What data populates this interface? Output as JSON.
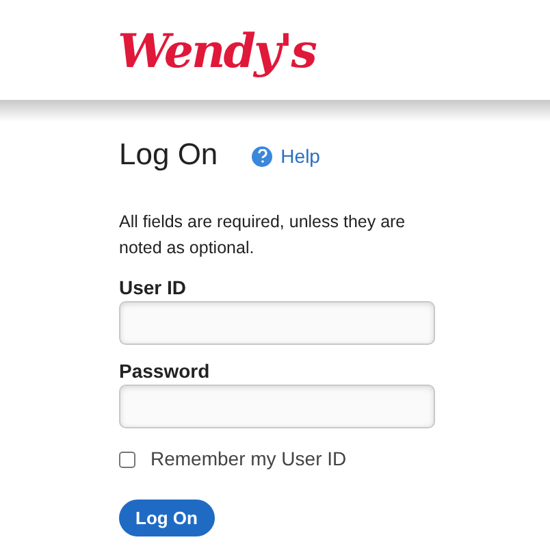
{
  "logo": "Wendy's",
  "title": "Log On",
  "help_link": "Help",
  "instructions": "All fields are required, unless they are noted as optional.",
  "fields": [
    {
      "label": "User ID"
    },
    {
      "label": "Password"
    }
  ],
  "remember": {
    "label": "Remember my User ID",
    "checked": false
  },
  "submit_button": "Log On"
}
